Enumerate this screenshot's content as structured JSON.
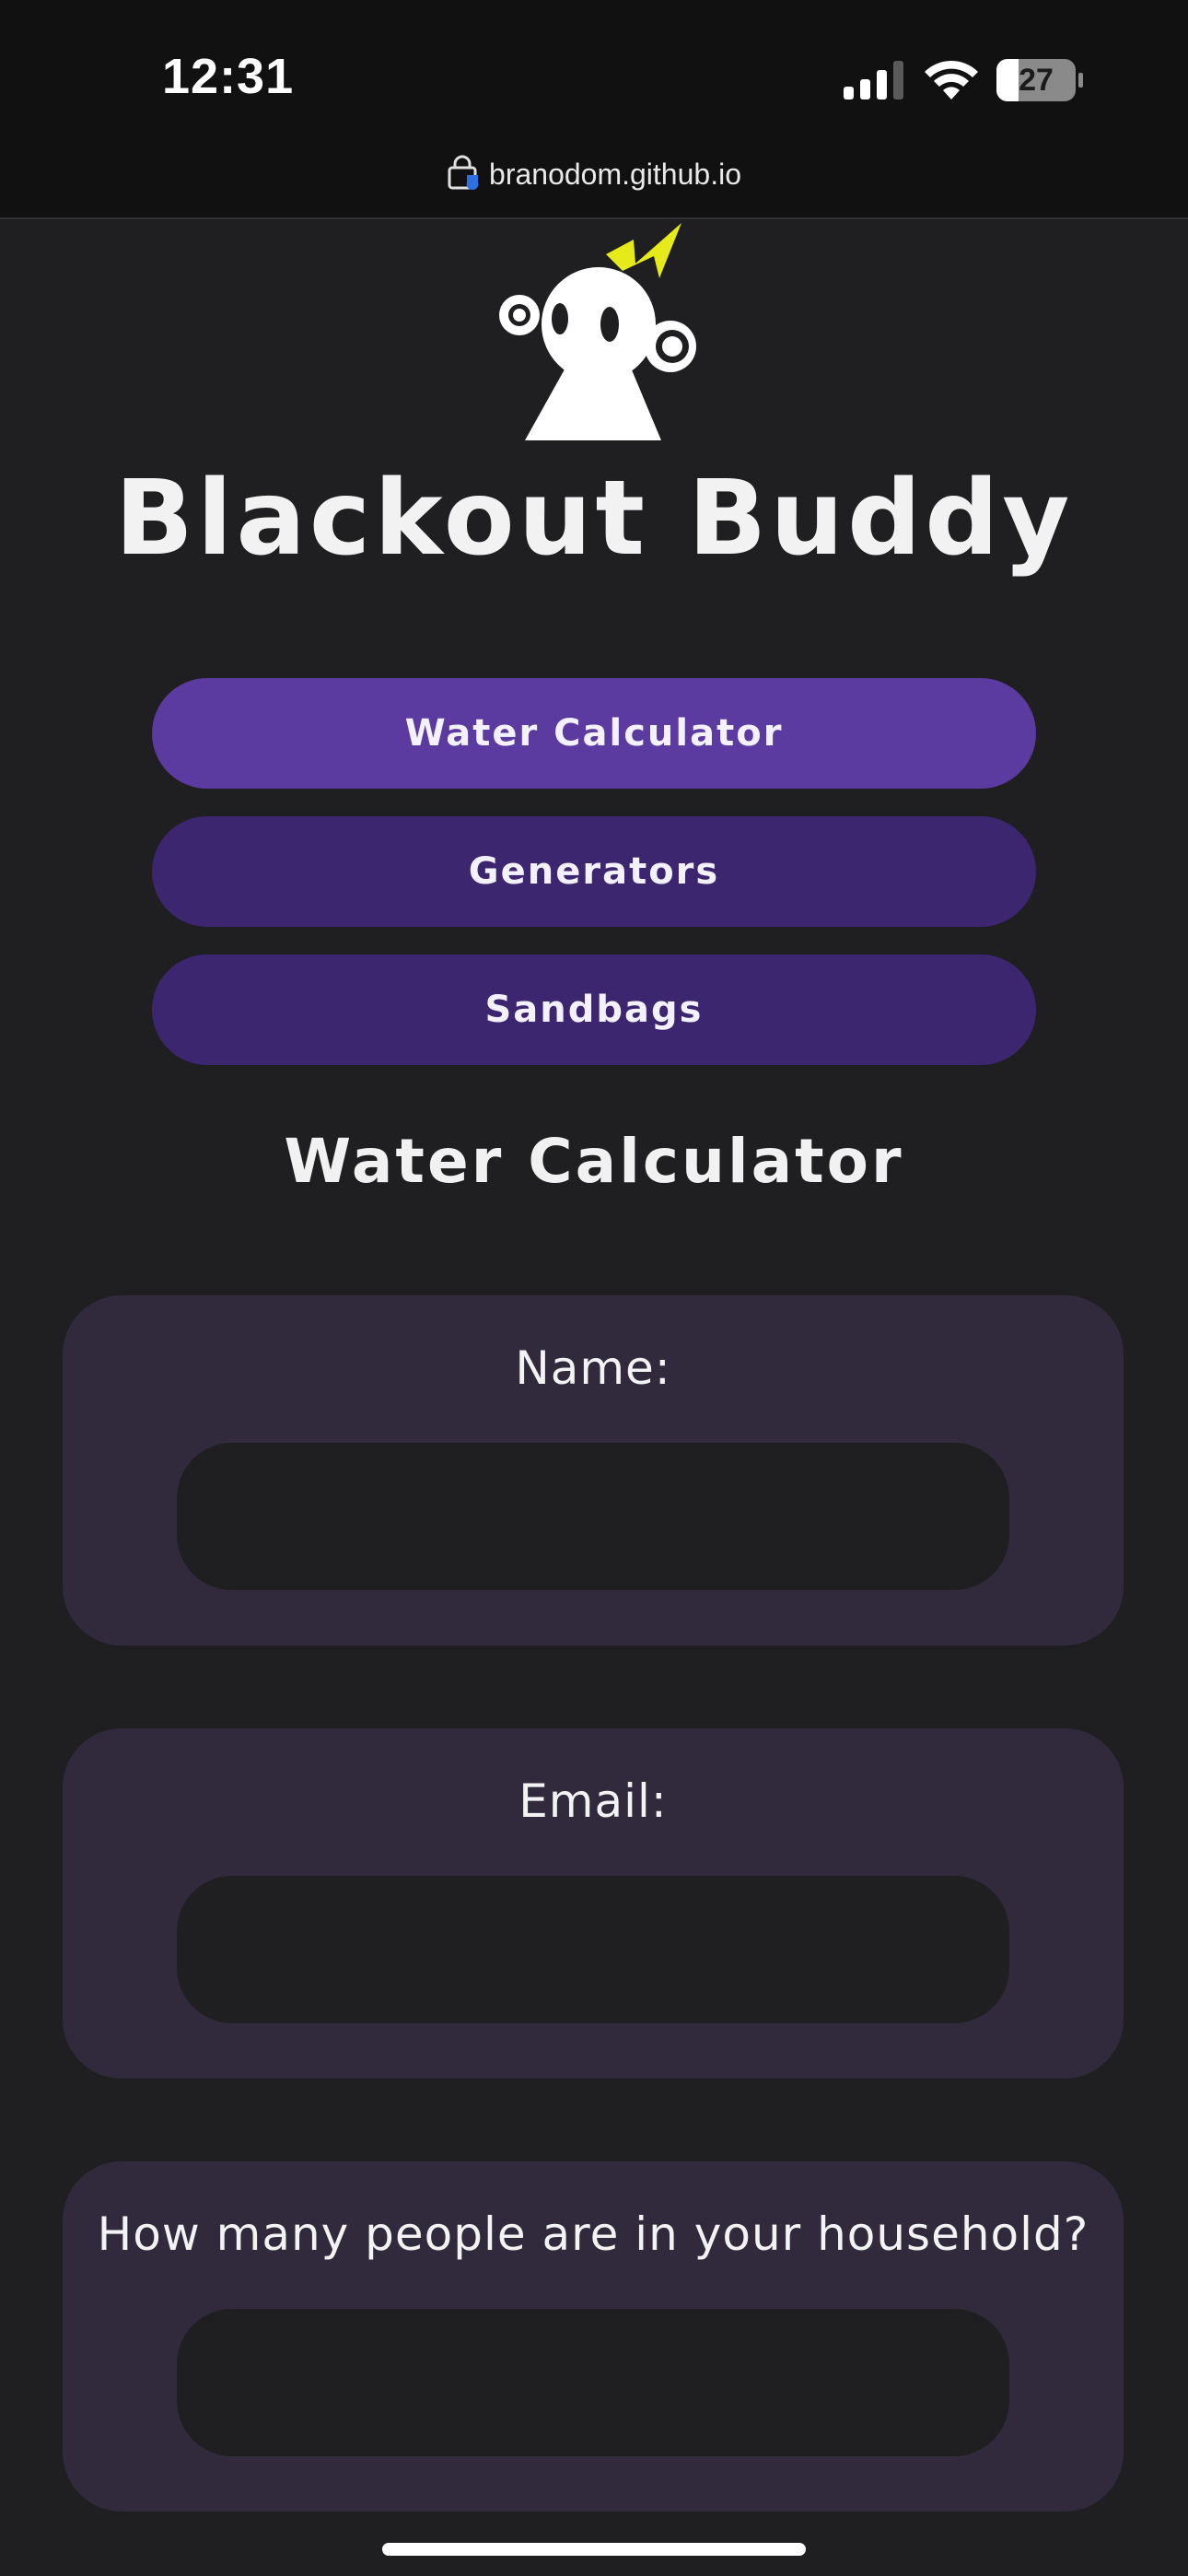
{
  "status_bar": {
    "time": "12:31",
    "battery": "27"
  },
  "browser": {
    "url": "branodom.github.io"
  },
  "header": {
    "title": "Blackout Buddy"
  },
  "nav": {
    "items": [
      {
        "label": "Water Calculator",
        "active": true
      },
      {
        "label": "Generators",
        "active": false
      },
      {
        "label": "Sandbags",
        "active": false
      }
    ]
  },
  "main": {
    "title": "Water Calculator",
    "fields": [
      {
        "label": "Name:",
        "value": ""
      },
      {
        "label": "Email:",
        "value": ""
      },
      {
        "label": "How many people are in your household?",
        "value": ""
      }
    ]
  },
  "colors": {
    "background": "#1f1f21",
    "nav_active": "#5b3b9f",
    "nav_idle": "#3d2670",
    "card": "#302a3c",
    "logo_accent": "#e6ea1b"
  }
}
